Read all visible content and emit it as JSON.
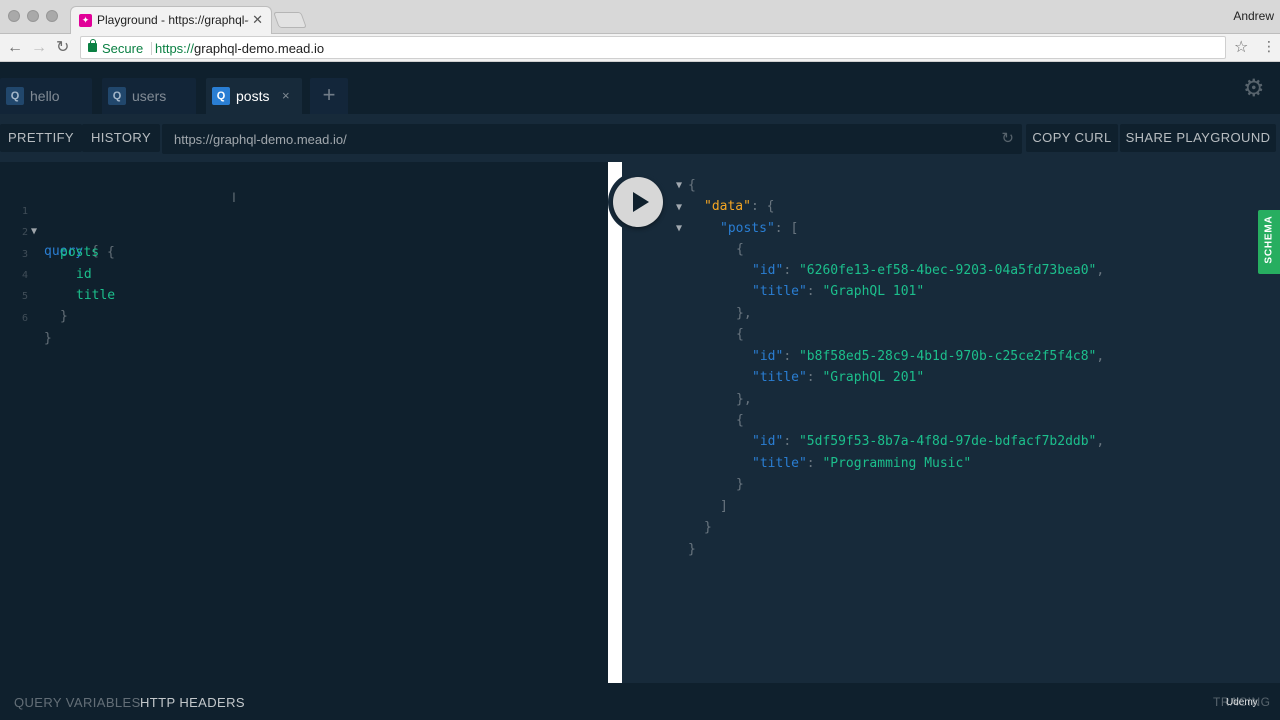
{
  "browser": {
    "tab_title": "Playground - https://graphql-demo.mead.io",
    "user": "Andrew",
    "secure_label": "Secure",
    "url_protocol": "https://",
    "url_host": "graphql-demo.mead.io"
  },
  "playground": {
    "tabs": [
      {
        "badge": "Q",
        "label": "hello"
      },
      {
        "badge": "Q",
        "label": "users"
      },
      {
        "badge": "Q",
        "label": "posts",
        "close": "×"
      }
    ],
    "add_tab": "+",
    "toolbar": {
      "prettify": "PRETTIFY",
      "history": "HISTORY",
      "endpoint": "https://graphql-demo.mead.io/",
      "copy_curl": "COPY CURL",
      "share": "SHARE PLAYGROUND"
    },
    "editor": {
      "line_numbers": [
        "1",
        "2",
        "3",
        "4",
        "5",
        "6"
      ],
      "lines": [
        {
          "keyword": "query",
          "punct": "{"
        },
        {
          "field": "posts",
          "punct": "{"
        },
        {
          "field": "id"
        },
        {
          "field": "title"
        },
        {
          "punct": "}"
        },
        {
          "punct": "}"
        }
      ]
    },
    "result": {
      "data_key": "\"data\"",
      "posts_key": "\"posts\"",
      "id_key": "\"id\"",
      "title_key": "\"title\"",
      "posts": [
        {
          "id": "\"6260fe13-ef58-4bec-9203-04a5fd73bea0\"",
          "title": "\"GraphQL 101\""
        },
        {
          "id": "\"b8f58ed5-28c9-4b1d-970b-c25ce2f5f4c8\"",
          "title": "\"GraphQL 201\""
        },
        {
          "id": "\"5df59f53-8b7a-4f8d-97de-bdfacf7b2ddb\"",
          "title": "\"Programming Music\""
        }
      ]
    },
    "schema_label": "SCHEMA",
    "bottom": {
      "query_variables": "QUERY VARIABLES",
      "http_headers": "HTTP HEADERS",
      "tracing": "TRACING"
    },
    "watermark": "Udemy"
  },
  "colors": {
    "bg": "#172a3a",
    "panel": "#0f202d",
    "keyword": "#2a7ed3",
    "field": "#1cbf8c",
    "top_key": "#f5a623",
    "schema": "#27ae60"
  },
  "icons": [
    "close-icon",
    "back-arrow-icon",
    "forward-arrow-icon",
    "reload-icon",
    "lock-icon",
    "star-icon",
    "menu-icon",
    "settings-gear-icon",
    "plus-icon",
    "play-icon",
    "fold-arrow-icon"
  ]
}
